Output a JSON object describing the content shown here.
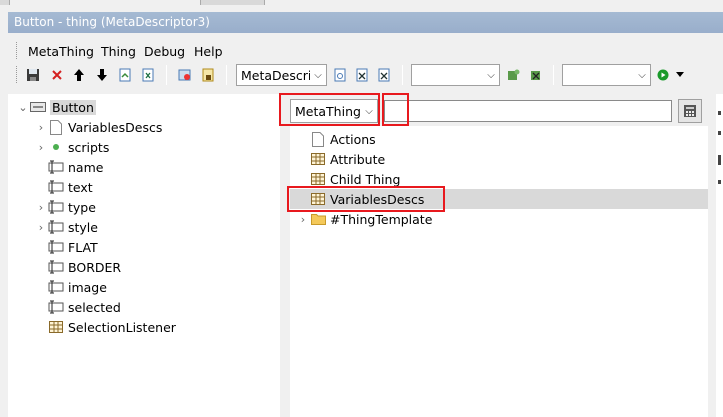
{
  "window": {
    "title": "Button - thing  (MetaDescriptor3)"
  },
  "menu": {
    "items": [
      "MetaThing",
      "Thing",
      "Debug",
      "Help"
    ]
  },
  "toolbar": {
    "combo1": {
      "value": "MetaDescri"
    },
    "combo2": {
      "value": ""
    },
    "combo3": {
      "value": ""
    }
  },
  "left_tree": {
    "root": "Button",
    "children": [
      "VariablesDescs",
      "scripts",
      "name",
      "text",
      "type",
      "style",
      "FLAT",
      "BORDER",
      "image",
      "selected",
      "SelectionListener"
    ]
  },
  "right_panel": {
    "category_select": {
      "value": "MetaThing"
    },
    "filter_input": {
      "value": ""
    },
    "items": [
      "Actions",
      "Attribute",
      "Child Thing",
      "VariablesDescs",
      "#ThingTemplate"
    ]
  },
  "colors": {
    "highlight_red": "#e8191e",
    "titlebar": "#a5bad3",
    "selection": "#d9d9d9"
  }
}
